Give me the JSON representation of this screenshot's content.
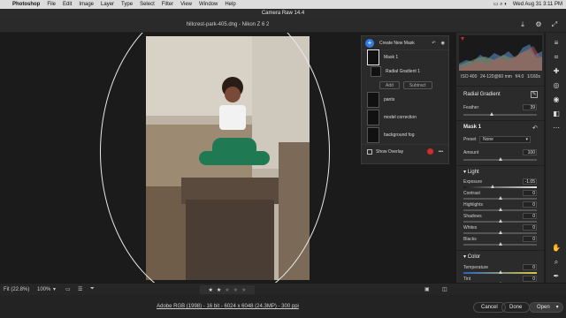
{
  "menubar": {
    "app": "Photoshop",
    "items": [
      "File",
      "Edit",
      "Image",
      "Layer",
      "Type",
      "Select",
      "Filter",
      "View",
      "Window",
      "Help"
    ],
    "datetime": "Wed Aug 31  3:11 PM"
  },
  "window": {
    "title": "Camera Raw 14.4"
  },
  "file": {
    "title": "hillcrest-park-405.dng  -  Nikon Z 6 2"
  },
  "masks_panel": {
    "create_label": "Create New Mask",
    "groups": [
      {
        "name": "Mask 1",
        "components": [
          "Radial Gradient 1"
        ],
        "add_label": "Add",
        "subtract_label": "Subtract"
      },
      {
        "name": "pants"
      },
      {
        "name": "model correction"
      },
      {
        "name": "background fog"
      }
    ],
    "show_overlay_label": "Show Overlay",
    "overlay_color": "#d22b2b"
  },
  "histogram_info": {
    "iso": "ISO 400",
    "lens": "24-120@60 mm",
    "aperture": "f/4.0",
    "shutter": "1/160s"
  },
  "radial": {
    "title": "Radial Gradient",
    "feather_label": "Feather",
    "feather_value": "39",
    "feather_level": 0.39
  },
  "mask": {
    "title": "Mask 1",
    "preset_label": "Preset",
    "preset_value": "None",
    "amount_label": "Amount",
    "amount_value": "100",
    "amount_level": 0.5
  },
  "light": {
    "title": "Light",
    "sliders": [
      {
        "label": "Exposure",
        "value": "-1.05",
        "level": 0.4
      },
      {
        "label": "Contrast",
        "value": "0",
        "level": 0.5
      },
      {
        "label": "Highlights",
        "value": "0",
        "level": 0.5
      },
      {
        "label": "Shadows",
        "value": "0",
        "level": 0.5
      },
      {
        "label": "Whites",
        "value": "0",
        "level": 0.5
      },
      {
        "label": "Blacks",
        "value": "0",
        "level": 0.5
      }
    ]
  },
  "color": {
    "title": "Color",
    "sliders": [
      {
        "label": "Temperature",
        "value": "0",
        "level": 0.5
      },
      {
        "label": "Tint",
        "value": "0",
        "level": 0.5
      }
    ]
  },
  "bottombar": {
    "zoom_fit": "Fit (22.8%)",
    "zoom": "100%",
    "rating_stars": 2,
    "rating_max": 5
  },
  "status": {
    "link": "Adobe RGB (1998) - 16 bit - 6024 x 6048 (24.3MP) - 300 ppi",
    "cancel": "Cancel",
    "done": "Done",
    "open": "Open"
  },
  "colors": {
    "accent": "#2f7de1",
    "overlay": "#d22b2b"
  }
}
